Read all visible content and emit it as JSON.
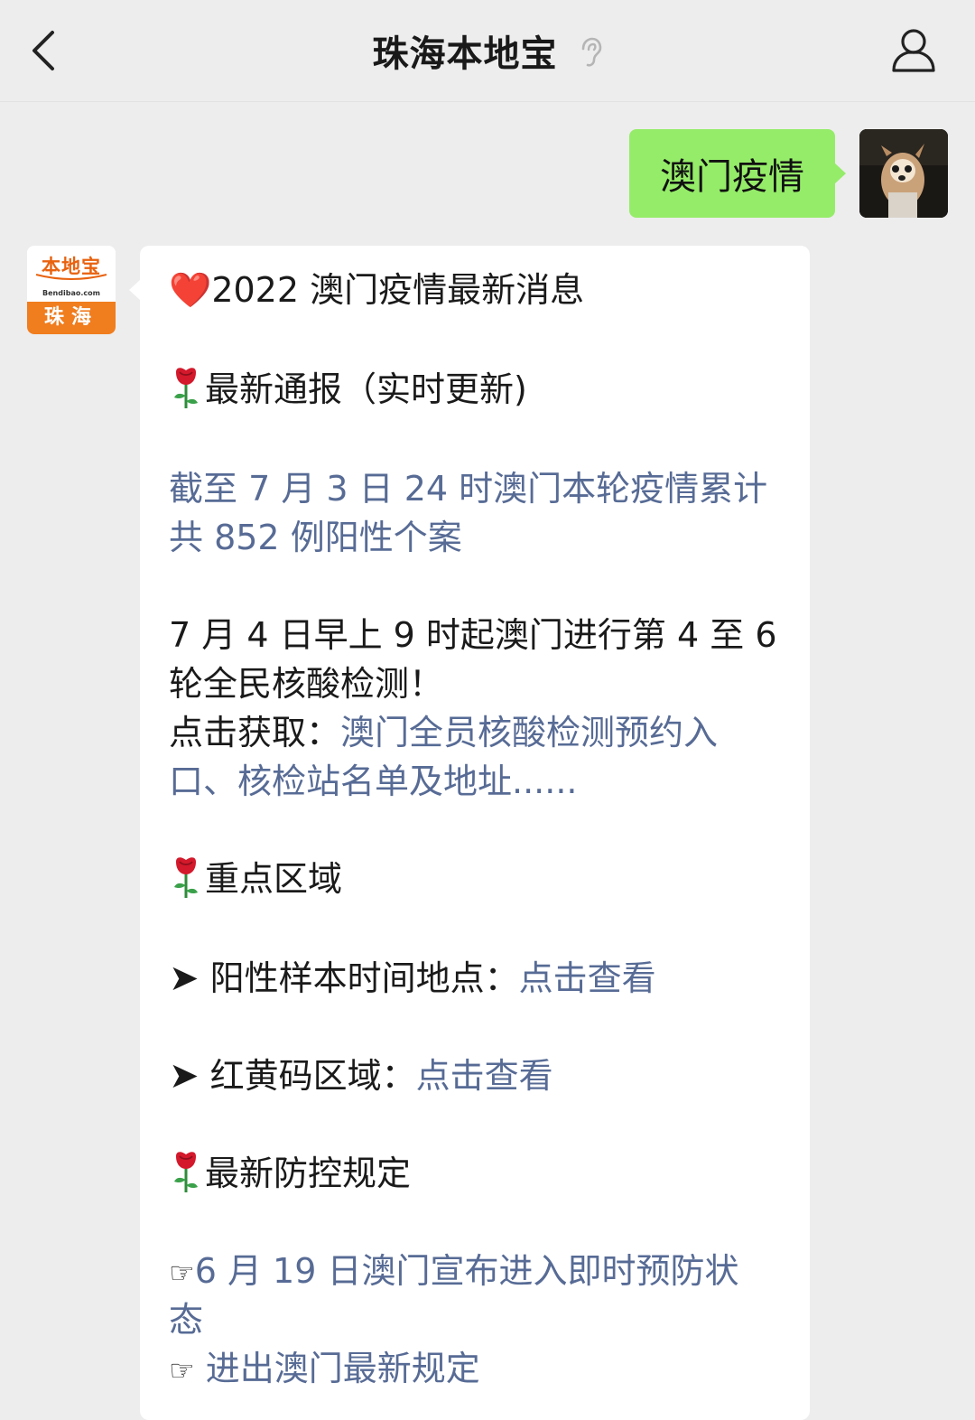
{
  "header": {
    "title": "珠海本地宝"
  },
  "user_message": {
    "text": "澳门疫情"
  },
  "bot": {
    "logo_text": "本地宝",
    "logo_domain": "Bendibao.com",
    "logo_city": "珠海"
  },
  "reply": {
    "title": "2022 澳门疫情最新消息",
    "heart": "❤️",
    "section1": "最新通报（实时更新)",
    "case_line1": "截至 7 月 3 日 24 时澳门本轮疫情累计",
    "case_line2": "共 852 例阳性个案",
    "test_line1": "7 月 4 日早上 9 时起澳门进行第 4 至 6",
    "test_line2": "轮全民核酸检测！",
    "click_label": "点击获取：",
    "test_link_line1": "澳门全员核酸检测预约入",
    "test_link_line2": "口、核检站名单及地址......",
    "section2": "重点区域",
    "arrow": "➤",
    "positive_label": "阳性样本时间地点：",
    "positive_link": "点击查看",
    "codes_label": "红黄码区域：",
    "codes_link": "点击查看",
    "section3": "最新防控规定",
    "hand": "☞",
    "rule1_line1": "6 月 19 日澳门宣布进入即时预防状",
    "rule1_line2": "态",
    "rule2": "进出澳门最新规定"
  },
  "colors": {
    "background": "#ededed",
    "user_bubble": "#95ec69",
    "link": "#576b95",
    "heart": "#e0162b",
    "brand_orange": "#f07d1e"
  },
  "icons": [
    "back-icon",
    "ear-icon",
    "profile-icon",
    "rose-icon",
    "heart-icon",
    "arrow-icon",
    "hand-pointer-icon"
  ]
}
